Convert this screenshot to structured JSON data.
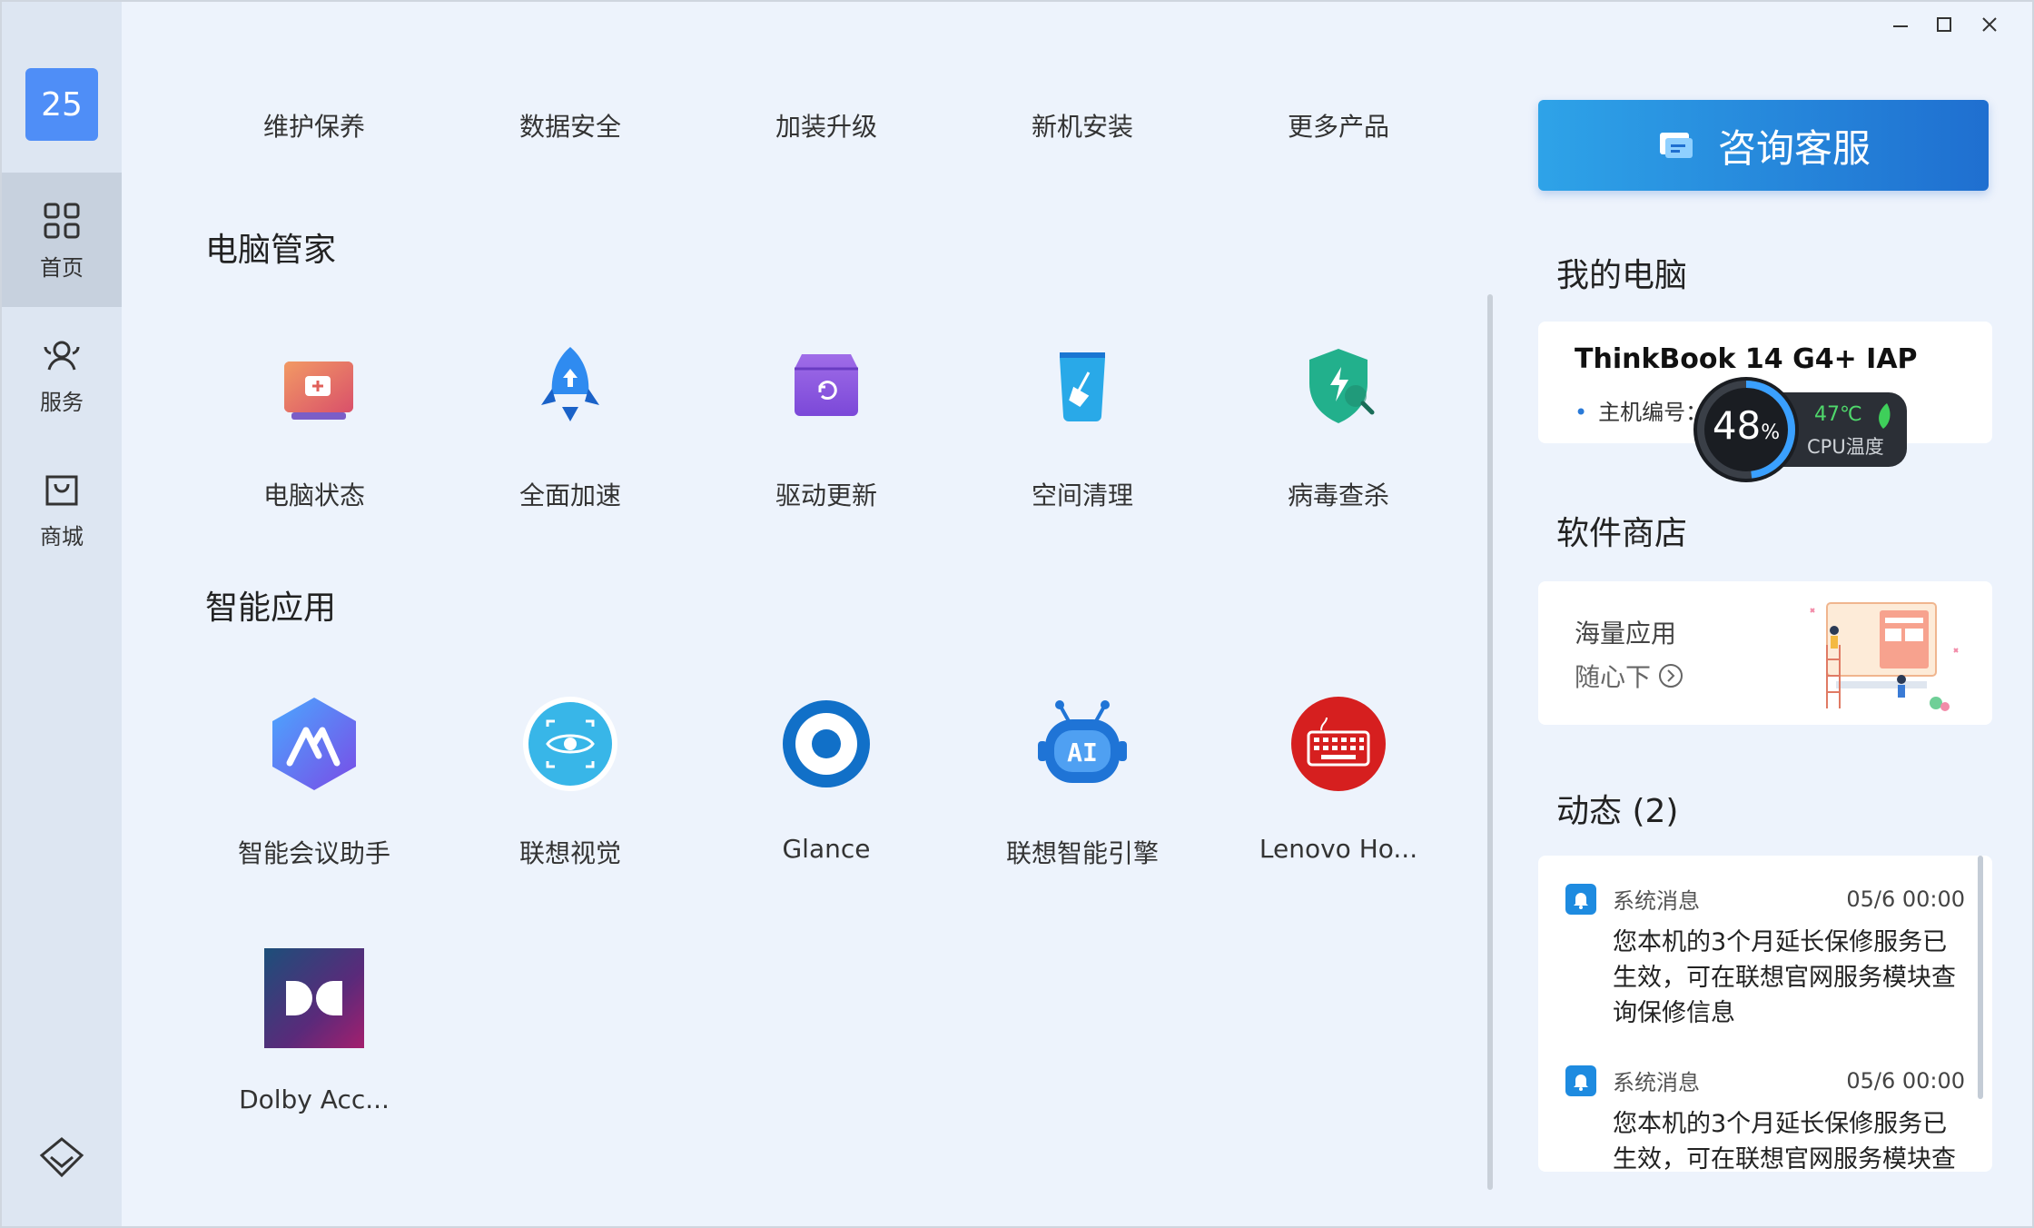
{
  "sidebar": {
    "avatar": "25",
    "items": [
      {
        "label": "首页",
        "icon": "grid-icon"
      },
      {
        "label": "服务",
        "icon": "users-icon"
      },
      {
        "label": "商城",
        "icon": "shopping-bag-icon"
      }
    ],
    "bottom_icon": "lenovo-diamond-icon"
  },
  "top_categories": [
    "维护保养",
    "数据安全",
    "加装升级",
    "新机安装",
    "更多产品"
  ],
  "sections": {
    "pc_manager": {
      "title": "电脑管家",
      "apps": [
        "电脑状态",
        "全面加速",
        "驱动更新",
        "空间清理",
        "病毒查杀"
      ]
    },
    "smart_apps": {
      "title": "智能应用",
      "apps": [
        "智能会议助手",
        "联想视觉",
        "Glance",
        "联想智能引擎",
        "Lenovo Ho...",
        "Dolby Acc..."
      ]
    }
  },
  "right": {
    "consult_label": "咨询客服",
    "my_pc": {
      "title": "我的电脑",
      "model": "ThinkBook 14 G4+ IAP",
      "id_label": "主机编号：",
      "cpu_usage": "48",
      "cpu_usage_unit": "%",
      "cpu_temp": "47℃",
      "cpu_temp_label": "CPU温度"
    },
    "store": {
      "title": "软件商店",
      "line1": "海量应用",
      "line2": "随心下"
    },
    "news": {
      "title": "动态 (2)",
      "messages": [
        {
          "source": "系统消息",
          "time": "05/6 00:00",
          "text": "您本机的3个月延长保修服务已生效，可在联想官网服务模块查询保修信息"
        },
        {
          "source": "系统消息",
          "time": "05/6 00:00",
          "text": "您本机的3个月延长保修服务已生效，可在联想官网服务模块查"
        }
      ]
    }
  },
  "colors": {
    "accent": "#1f6fd0",
    "window_bg": "#edf3fc",
    "sidebar_bg": "#dde6f2"
  }
}
